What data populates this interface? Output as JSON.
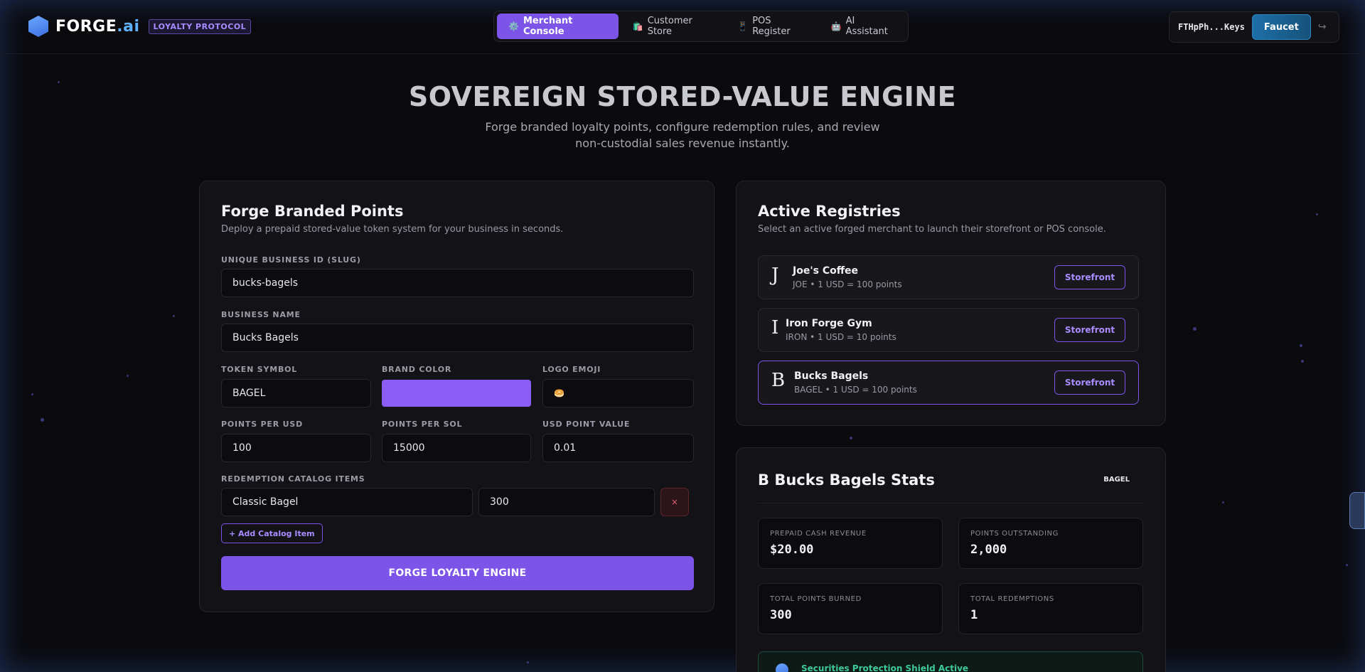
{
  "header": {
    "brand_name": "FORGE",
    "brand_suffix": ".ai",
    "brand_badge": "LOYALTY PROTOCOL",
    "tabs": [
      {
        "label": "Merchant Console",
        "icon": "⚙️",
        "active": true
      },
      {
        "label": "Customer Store",
        "icon": "🛍️",
        "active": false
      },
      {
        "label": "POS Register",
        "icon": "📱",
        "active": false
      },
      {
        "label": "AI Assistant",
        "icon": "🤖",
        "active": false
      }
    ],
    "wallet_address": "FTHpPh...Keys",
    "faucet_label": "Faucet",
    "logout_icon": "↪"
  },
  "hero": {
    "title": "SOVEREIGN STORED-VALUE ENGINE",
    "subtitle": "Forge branded loyalty points, configure redemption rules, and review non-custodial sales revenue instantly."
  },
  "forge_form": {
    "title": "Forge Branded Points",
    "subtitle": "Deploy a prepaid stored-value token system for your business in seconds.",
    "slug_label": "UNIQUE BUSINESS ID (SLUG)",
    "slug_value": "bucks-bagels",
    "name_label": "BUSINESS NAME",
    "name_value": "Bucks Bagels",
    "symbol_label": "TOKEN SYMBOL",
    "symbol_value": "BAGEL",
    "color_label": "BRAND COLOR",
    "color_value": "#8b5cf6",
    "emoji_label": "LOGO EMOJI",
    "emoji_value": "🥯",
    "ppu_label": "POINTS PER USD",
    "ppu_value": "100",
    "pps_label": "POINTS PER SOL",
    "pps_value": "15000",
    "upv_label": "USD POINT VALUE",
    "upv_value": "0.01",
    "catalog_label": "REDEMPTION CATALOG ITEMS",
    "catalog_items": [
      {
        "name": "Classic Bagel",
        "cost": "300"
      }
    ],
    "remove_icon": "×",
    "add_item_label": "+ Add Catalog Item",
    "submit_label": "FORGE LOYALTY ENGINE"
  },
  "registries": {
    "title": "Active Registries",
    "subtitle": "Select an active forged merchant to launch their storefront or POS console.",
    "items": [
      {
        "letter": "J",
        "name": "Joe's Coffee",
        "meta": "JOE • 1 USD = 100 points",
        "button": "Storefront"
      },
      {
        "letter": "I",
        "name": "Iron Forge Gym",
        "meta": "IRON • 1 USD = 10 points",
        "button": "Storefront"
      },
      {
        "letter": "B",
        "name": "Bucks Bagels",
        "meta": "BAGEL • 1 USD = 100 points",
        "button": "Storefront"
      }
    ]
  },
  "stats": {
    "title": "B Bucks Bagels Stats",
    "symbol": "BAGEL",
    "boxes": [
      {
        "label": "PREPAID CASH REVENUE",
        "value": "$20.00"
      },
      {
        "label": "POINTS OUTSTANDING",
        "value": "2,000"
      },
      {
        "label": "TOTAL POINTS BURNED",
        "value": "300"
      },
      {
        "label": "TOTAL REDEMPTIONS",
        "value": "1"
      }
    ],
    "shield_text": "Securities Protection Shield Active"
  }
}
